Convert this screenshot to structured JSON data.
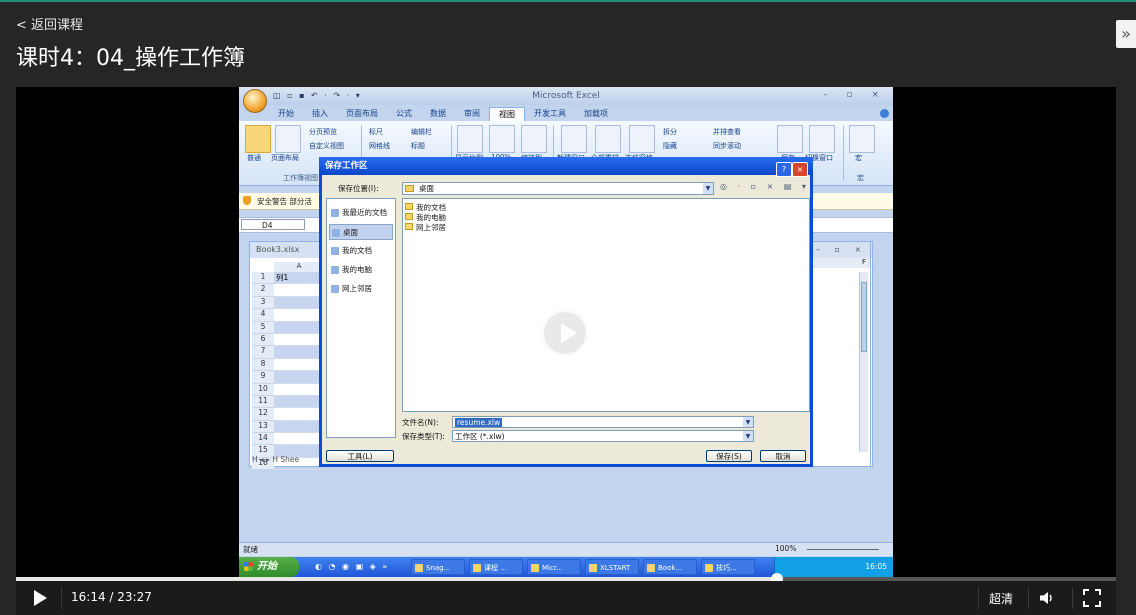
{
  "header": {
    "back_label": "< 返回课程",
    "lesson_title": "课时4：04_操作工作簿",
    "side_toggle": "»"
  },
  "excel": {
    "app_title": "Microsoft Excel",
    "qat": "◫ ▫ ▪ ↶ · ↷ · ▾",
    "win_controls": "–  ▫  ×",
    "ribbon_tabs": [
      "开始",
      "插入",
      "页面布局",
      "公式",
      "数据",
      "审阅",
      "视图",
      "开发工具",
      "加载项"
    ],
    "active_tab": "视图",
    "ribbon": {
      "normal": "普通",
      "page_layout": "页面布局",
      "page_break": "分页预览",
      "custom_views": "自定义视图",
      "ruler": "标尺",
      "gridlines": "网格线",
      "formula_bar": "编辑栏",
      "headings": "标题",
      "zoom": "显示比例",
      "zoom100": "100%",
      "zoom_sel": "缩放到",
      "new_window": "新建窗口",
      "arrange_all": "全部重排",
      "freeze": "冻结窗格",
      "split": "拆分",
      "hide": "隐藏",
      "side_by_side": "并排查看",
      "sync_scroll": "同步滚动",
      "save_ws": "保存",
      "switch_win": "切换窗口",
      "macros": "宏",
      "group_workbook_views": "工作簿视图",
      "group_macros": "宏"
    },
    "security_text": "安全警告  部分活",
    "name_box": "D4",
    "workbook_name": "Book3.xlsx",
    "workbook_ctrls": "– ▫ ×",
    "col_header_a": "A",
    "cell_a1": "列1",
    "row_numbers": [
      "1",
      "2",
      "3",
      "4",
      "5",
      "6",
      "7",
      "8",
      "9",
      "10",
      "11",
      "12",
      "13",
      "14",
      "15",
      "16"
    ],
    "sheet_tab": "H ◂ ▸ H  Shee",
    "right_col": "F",
    "status_ready": "就绪",
    "zoom_level": "100%"
  },
  "dialog": {
    "title": "保存工作区",
    "help": "?",
    "close": "×",
    "save_in_label": "保存位置(I):",
    "save_in_value": "桌面",
    "tools_icons": "◎ · ▫ × ▤ ▾",
    "places": [
      "我最近的文档",
      "桌面",
      "我的文档",
      "我的电脑",
      "网上邻居"
    ],
    "selected_place": "桌面",
    "files": [
      "我的文档",
      "我的电脑",
      "网上邻居"
    ],
    "filename_label": "文件名(N):",
    "filename_value": "resume.xlw",
    "filetype_label": "保存类型(T):",
    "filetype_value": "工作区 (*.xlw)",
    "tools_button": "工具(L)",
    "save_button": "保存(S)",
    "cancel_button": "取消"
  },
  "taskbar": {
    "start_label": "开始",
    "quick_icons": "◐ ◔ ◉ ▣ ◈ »",
    "tasks": [
      "Snag...",
      "课程 ...",
      "Micr...",
      "XLSTART",
      "Book...",
      "技巧..."
    ],
    "tray_time": "16:05"
  },
  "player": {
    "current_time": "16:14",
    "total_time": "23:27",
    "time_text": "16:14 / 23:27",
    "progress": 0.692,
    "quality_label": "超清"
  }
}
